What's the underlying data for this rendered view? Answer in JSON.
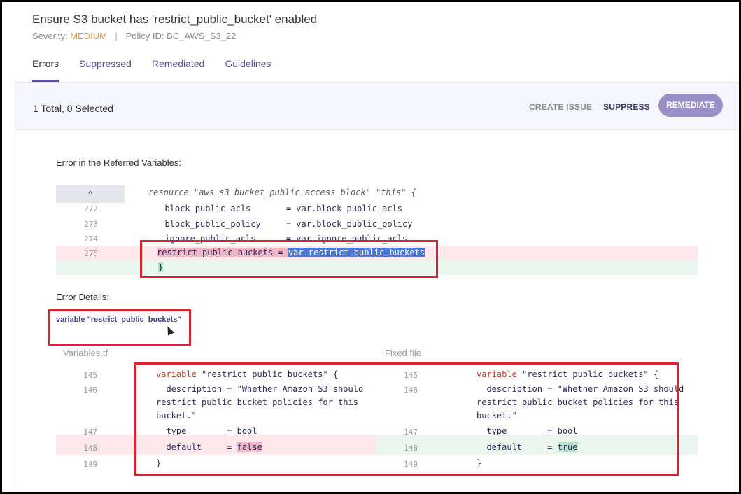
{
  "header": {
    "title": "Ensure S3 bucket has 'restrict_public_bucket' enabled",
    "severity_label": "Severity:",
    "severity_value": "MEDIUM",
    "separator": "|",
    "policy_id": "Policy ID: BC_AWS_S3_22"
  },
  "tabs": [
    {
      "label": "Errors"
    },
    {
      "label": "Suppressed"
    },
    {
      "label": "Remediated"
    },
    {
      "label": "Guidelines"
    }
  ],
  "toolbar": {
    "count": "1 Total, 0 Selected",
    "create_issue": "CREATE ISSUE",
    "suppress": "SUPPRESS",
    "remediate": "REMEDIATE"
  },
  "referred": {
    "label": "Error in the Referred Variables:",
    "collapse_icon": "^",
    "resource_line": "resource \"aws_s3_bucket_public_access_block\" \"this\" {",
    "lines": [
      {
        "num": "272",
        "text": "  block_public_acls       = var.block_public_acls"
      },
      {
        "num": "273",
        "text": "  block_public_policy     = var.block_public_policy"
      },
      {
        "num": "274",
        "text": "  ignore_public_acls      = var.ignore_public_acls"
      },
      {
        "num": "275",
        "key": "restrict_public_buckets",
        "eq": "=",
        "value": "var.restrict_public_buckets"
      }
    ],
    "closing": "}"
  },
  "details": {
    "label": "Error Details:",
    "variable_link": "variable \"restrict_public_buckets\""
  },
  "left_file": {
    "title": "Variables.tf",
    "lines": [
      {
        "num": "145",
        "kw": "variable",
        "rest": " \"restrict_public_buckets\" {"
      },
      {
        "num": "146",
        "text": "  description = \"Whether Amazon S3 should"
      },
      {
        "text": "restrict public bucket policies for this"
      },
      {
        "text": "bucket.\""
      },
      {
        "num": "147",
        "text": "  type        = bool"
      },
      {
        "num": "148",
        "key": "  default     =",
        "value": "false"
      },
      {
        "num": "149",
        "text": "}"
      }
    ]
  },
  "right_file": {
    "title": "Fixed file",
    "lines": [
      {
        "num": "145",
        "kw": "variable",
        "rest": " \"restrict_public_buckets\" {"
      },
      {
        "num": "146",
        "text": "  description = \"Whether Amazon S3 should"
      },
      {
        "text": "restrict public bucket policies for this"
      },
      {
        "text": "bucket.\""
      },
      {
        "num": "147",
        "text": "  type        = bool"
      },
      {
        "num": "148",
        "key": "  default     =",
        "value": "true"
      },
      {
        "num": "149",
        "text": "}"
      }
    ]
  },
  "colors": {
    "accent": "#5b4f9d",
    "severity": "#e8963a",
    "remediate_button": "#9b8fc8",
    "annotation_box": "#e0202c",
    "error_row": "#fde8ec",
    "fix_row": "#ebf6ee"
  }
}
